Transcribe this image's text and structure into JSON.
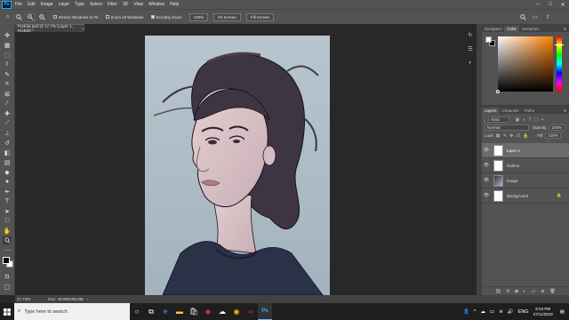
{
  "app": {
    "logo_text": "Ps",
    "menu": [
      "File",
      "Edit",
      "Image",
      "Layer",
      "Type",
      "Select",
      "Filter",
      "3D",
      "View",
      "Window",
      "Help"
    ],
    "window_controls": [
      "–",
      "□",
      "✕"
    ]
  },
  "options_bar": {
    "resize_windows": "Resize Windows to Fit",
    "zoom_all_windows": "Zoom All Windows",
    "scrubby_zoom": "Scrubby Zoom",
    "zoom_percent": "100%",
    "fit_screen": "Fit Screen",
    "fill_screen": "Fill Screen"
  },
  "document": {
    "tab_title": "Portrait.psd @ 17.7% (Layer 1, RGB/8) *",
    "tab_close": "×"
  },
  "color_panel": {
    "tabs": [
      "Navigator",
      "Color",
      "Swatches"
    ],
    "active_tab": "Color",
    "hue_color": "#ff7f00"
  },
  "layers_panel": {
    "tabs": [
      "Layers",
      "Channels",
      "Paths"
    ],
    "active_tab": "Layers",
    "filter_kind": "Kind",
    "blend_mode": "Normal",
    "opacity_label": "Opacity:",
    "opacity_value": "100%",
    "lock_label": "Lock:",
    "fill_label": "Fill:",
    "fill_value": "100%",
    "layers": [
      {
        "name": "Layer 1",
        "selected": true
      },
      {
        "name": "Outline",
        "selected": false
      },
      {
        "name": "Image",
        "selected": false
      },
      {
        "name": "Background",
        "selected": false,
        "locked": true
      }
    ]
  },
  "status_bar": {
    "zoom": "17.74%",
    "doc": "Doc: 49.8M/186.8M"
  },
  "taskbar": {
    "search_placeholder": "Type here to search",
    "language": "ENG",
    "time": "6:03 PM",
    "date": "27/11/2019"
  }
}
